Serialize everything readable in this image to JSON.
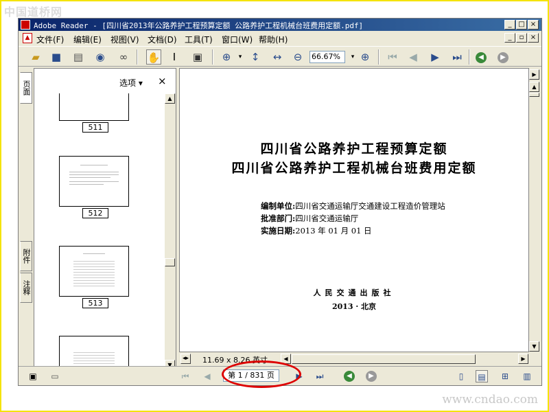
{
  "watermark": {
    "top": "中国道桥网",
    "bottom": "www.cndao.com"
  },
  "window": {
    "title": "Adobe Reader - [四川省2013年公路养护工程预算定额 公路养护工程机械台班费用定额.pdf]"
  },
  "menu": [
    "文件(F)",
    "编辑(E)",
    "视图(V)",
    "文档(D)",
    "工具(T)",
    "窗口(W)",
    "帮助(H)"
  ],
  "toolbar": {
    "zoom": "66.67%"
  },
  "sidebar": {
    "tabs": [
      "页面",
      "附件",
      "注释"
    ],
    "options_label": "选项",
    "thumbnails": [
      "511",
      "512",
      "513"
    ]
  },
  "document": {
    "title_line1": "四川省公路养护工程预算定额",
    "title_line2": "四川省公路养护工程机械台班费用定额",
    "compiler_label": "编制单位:",
    "compiler": "四川省交通运输厅交通建设工程造价管理站",
    "approver_label": "批准部门:",
    "approver": "四川省交通运输厅",
    "effective_label": "实施日期:",
    "effective": "2013 年 01 月 01 日",
    "publisher": "人民交通出版社",
    "pub_date": "2013 · 北京"
  },
  "page_size": "11.69 x 8.26 英寸",
  "status": {
    "page_indicator": "第 1 / 831 页"
  },
  "colors": {
    "title_bar": "#0a246a",
    "highlight_ring": "#dd0000",
    "border": "#f5e300"
  }
}
